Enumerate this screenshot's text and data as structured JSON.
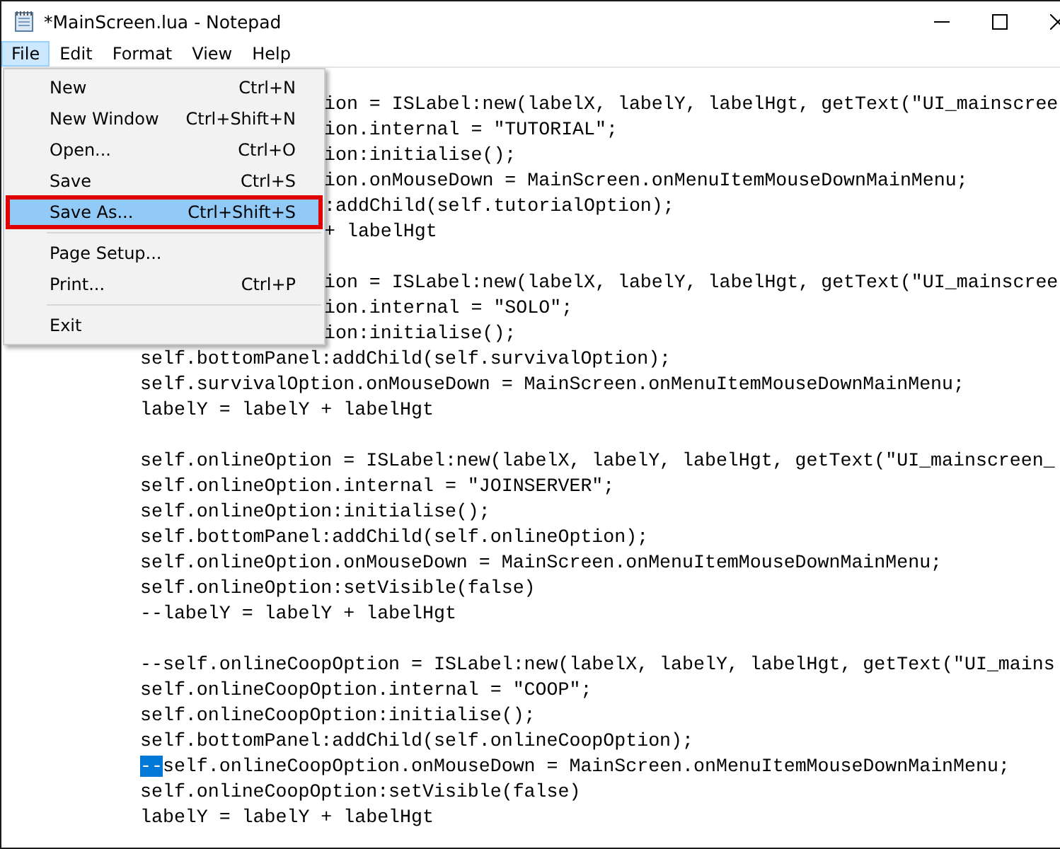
{
  "window": {
    "title": "*MainScreen.lua - Notepad"
  },
  "menu_bar": [
    {
      "label": "File",
      "selected": true
    },
    {
      "label": "Edit",
      "selected": false
    },
    {
      "label": "Format",
      "selected": false
    },
    {
      "label": "View",
      "selected": false
    },
    {
      "label": "Help",
      "selected": false
    }
  ],
  "file_menu": [
    {
      "kind": "item",
      "label": "New",
      "shortcut": "Ctrl+N",
      "selected": false,
      "outlined": false
    },
    {
      "kind": "item",
      "label": "New Window",
      "shortcut": "Ctrl+Shift+N",
      "selected": false,
      "outlined": false
    },
    {
      "kind": "item",
      "label": "Open...",
      "shortcut": "Ctrl+O",
      "selected": false,
      "outlined": false
    },
    {
      "kind": "item",
      "label": "Save",
      "shortcut": "Ctrl+S",
      "selected": false,
      "outlined": false
    },
    {
      "kind": "item",
      "label": "Save As...",
      "shortcut": "Ctrl+Shift+S",
      "selected": true,
      "outlined": true
    },
    {
      "kind": "separator"
    },
    {
      "kind": "item",
      "label": "Page Setup...",
      "selected": false,
      "outlined": false
    },
    {
      "kind": "item",
      "label": "Print...",
      "shortcut": "Ctrl+P",
      "selected": false,
      "outlined": false
    },
    {
      "kind": "separator"
    },
    {
      "kind": "item",
      "label": "Exit",
      "selected": false,
      "outlined": false
    }
  ],
  "editor_lines": [
    {
      "kind": "partial",
      "text": "ion = ISLabel:new(labelX, labelY, labelHgt, getText(\"UI_mainscree"
    },
    {
      "kind": "partial",
      "text": "ion.internal = \"TUTORIAL\";"
    },
    {
      "kind": "partial",
      "text": "ion:initialise();"
    },
    {
      "kind": "partial",
      "text": "ion.onMouseDown = MainScreen.onMenuItemMouseDownMainMenu;"
    },
    {
      "kind": "partial",
      "text": ":addChild(self.tutorialOption);"
    },
    {
      "kind": "partial",
      "text": "+ labelHgt"
    },
    {
      "kind": "blank"
    },
    {
      "kind": "partial",
      "text": "ion = ISLabel:new(labelX, labelY, labelHgt, getText(\"UI_mainscree"
    },
    {
      "kind": "partial",
      "text": "ion.internal = \"SOLO\";"
    },
    {
      "kind": "partial",
      "text": "ion:initialise();"
    },
    {
      "kind": "full",
      "text": "self.bottomPanel:addChild(self.survivalOption);"
    },
    {
      "kind": "full",
      "text": "self.survivalOption.onMouseDown = MainScreen.onMenuItemMouseDownMainMenu;"
    },
    {
      "kind": "full",
      "text": "labelY = labelY + labelHgt"
    },
    {
      "kind": "blank"
    },
    {
      "kind": "full",
      "text": "self.onlineOption = ISLabel:new(labelX, labelY, labelHgt, getText(\"UI_mainscreen_"
    },
    {
      "kind": "full",
      "text": "self.onlineOption.internal = \"JOINSERVER\";"
    },
    {
      "kind": "full",
      "text": "self.onlineOption:initialise();"
    },
    {
      "kind": "full",
      "text": "self.bottomPanel:addChild(self.onlineOption);"
    },
    {
      "kind": "full",
      "text": "self.onlineOption.onMouseDown = MainScreen.onMenuItemMouseDownMainMenu;"
    },
    {
      "kind": "full",
      "text": "self.onlineOption:setVisible(false)"
    },
    {
      "kind": "full",
      "text": "--labelY = labelY + labelHgt"
    },
    {
      "kind": "blank"
    },
    {
      "kind": "full",
      "text": "--self.onlineCoopOption = ISLabel:new(labelX, labelY, labelHgt, getText(\"UI_mains"
    },
    {
      "kind": "full",
      "text": "self.onlineCoopOption.internal = \"COOP\";"
    },
    {
      "kind": "full",
      "text": "self.onlineCoopOption:initialise();"
    },
    {
      "kind": "full",
      "text": "self.bottomPanel:addChild(self.onlineCoopOption);"
    },
    {
      "kind": "segmented",
      "segments": [
        {
          "text": "--",
          "selected": true
        },
        {
          "text": "self.onlineCoopOption.onMouseDown = MainScreen.onMenuItemMouseDownMainMenu;",
          "selected": false
        }
      ]
    },
    {
      "kind": "full",
      "text": "self.onlineCoopOption:setVisible(false)"
    },
    {
      "kind": "full",
      "text": "labelY = labelY + labelHgt"
    }
  ]
}
